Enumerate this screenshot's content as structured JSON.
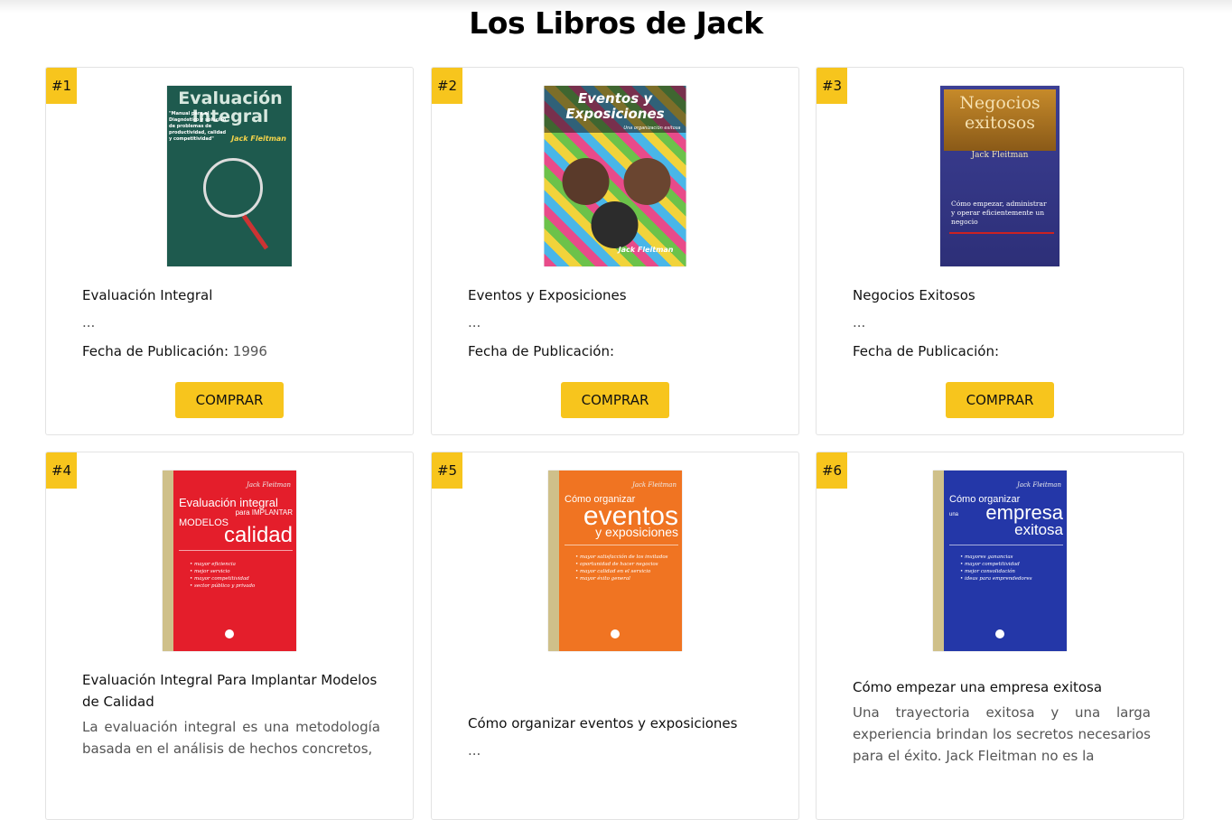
{
  "page": {
    "title": "Los Libros de Jack"
  },
  "books": [
    {
      "rank": "#1",
      "title": "Evaluación Integral",
      "desc": "...",
      "pub_label": "Fecha de Publicación:",
      "pub_value": "1996",
      "buy_label": "COMPRAR",
      "cover": {
        "title": "Evaluación Integral",
        "author": "Jack Fleitman",
        "blurb": "\"Manual para el Diagnóstico y solución de problemas de productividad, calidad y competitividad\""
      }
    },
    {
      "rank": "#2",
      "title": "Eventos y Exposiciones",
      "desc": "...",
      "pub_label": "Fecha de Publicación:",
      "pub_value": "",
      "buy_label": "COMPRAR",
      "cover": {
        "title": "Eventos y Exposiciones",
        "subtitle": "Una organización exitosa",
        "author": "Jack Fleitman"
      }
    },
    {
      "rank": "#3",
      "title": "Negocios Exitosos",
      "desc": "...",
      "pub_label": "Fecha de Publicación:",
      "pub_value": "",
      "buy_label": "COMPRAR",
      "cover": {
        "title": "Negocios exitosos",
        "author": "Jack Fleitman",
        "blurb": "Cómo empezar, administrar y operar eficientemente un negocio"
      }
    },
    {
      "rank": "#4",
      "title": "Evaluación Integral Para Implantar Modelos de Calidad",
      "desc": "La evaluación integral es una metodología basada en el análisis de hechos concretos,",
      "cover": {
        "author": "Jack Fleitman",
        "line1": "Evaluación integral",
        "line2": "para IMPLANTAR",
        "line3": "MODELOS",
        "line4": "calidad",
        "bullets": [
          "• mayor eficiencia",
          "• mejor servicio",
          "• mayor competitividad",
          "• sector público y privado"
        ]
      }
    },
    {
      "rank": "#5",
      "title": "Cómo organizar eventos y exposiciones",
      "desc": "...",
      "cover": {
        "author": "Jack Fleitman",
        "line1": "Cómo organizar",
        "line2": "eventos",
        "line3": "y exposiciones",
        "bullets": [
          "• mayor satisfacción de los invitados",
          "• oportunidad de hacer negocios",
          "• mayor calidad en el servicio",
          "• mayor éxito general"
        ]
      }
    },
    {
      "rank": "#6",
      "title": "Cómo empezar una empresa exitosa",
      "desc": "Una trayectoria exitosa y una larga experiencia brindan los secretos necesarios para el éxito. Jack Fleitman no es la",
      "cover": {
        "author": "Jack Fleitman",
        "line1": "Cómo organizar",
        "line2": "una",
        "line3": "empresa",
        "line4": "exitosa",
        "bullets": [
          "• mayores ganancias",
          "• mayor competitividad",
          "• mejor consolidación",
          "• ideas para emprendedores"
        ]
      }
    }
  ],
  "colors": {
    "accent": "#f7c51d",
    "border": "#e3e3e3"
  }
}
